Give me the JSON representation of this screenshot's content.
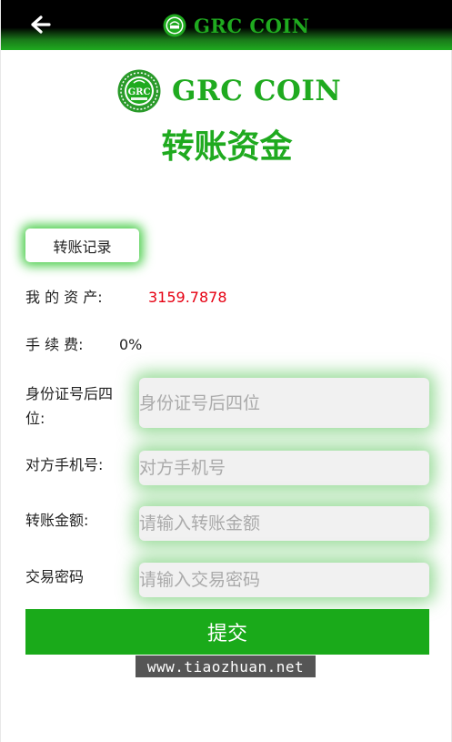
{
  "header": {
    "brand": "GRC COIN",
    "back_icon": "arrow-left-icon"
  },
  "logo": {
    "emblem_text": "GRC",
    "text": "GRC COIN"
  },
  "page": {
    "title": "转账资金"
  },
  "record_button": "转账记录",
  "assets": {
    "label": "我 的 资 产:",
    "value": "3159.7878"
  },
  "fee": {
    "label": "手 续 费:",
    "value": "0%"
  },
  "fields": {
    "id_last4": {
      "label": "身份证号后四位:",
      "placeholder": "身份证号后四位"
    },
    "phone": {
      "label": "对方手机号:",
      "placeholder": "对方手机号"
    },
    "amount": {
      "label": "转账金额:",
      "placeholder": "请输入转账金额"
    },
    "password": {
      "label": "交易密码",
      "placeholder": "请输入交易密码"
    }
  },
  "submit_button": "提交",
  "watermark": "www.tiaozhuan.net",
  "colors": {
    "brand_green": "#1faa1f",
    "asset_red": "#e60012"
  }
}
